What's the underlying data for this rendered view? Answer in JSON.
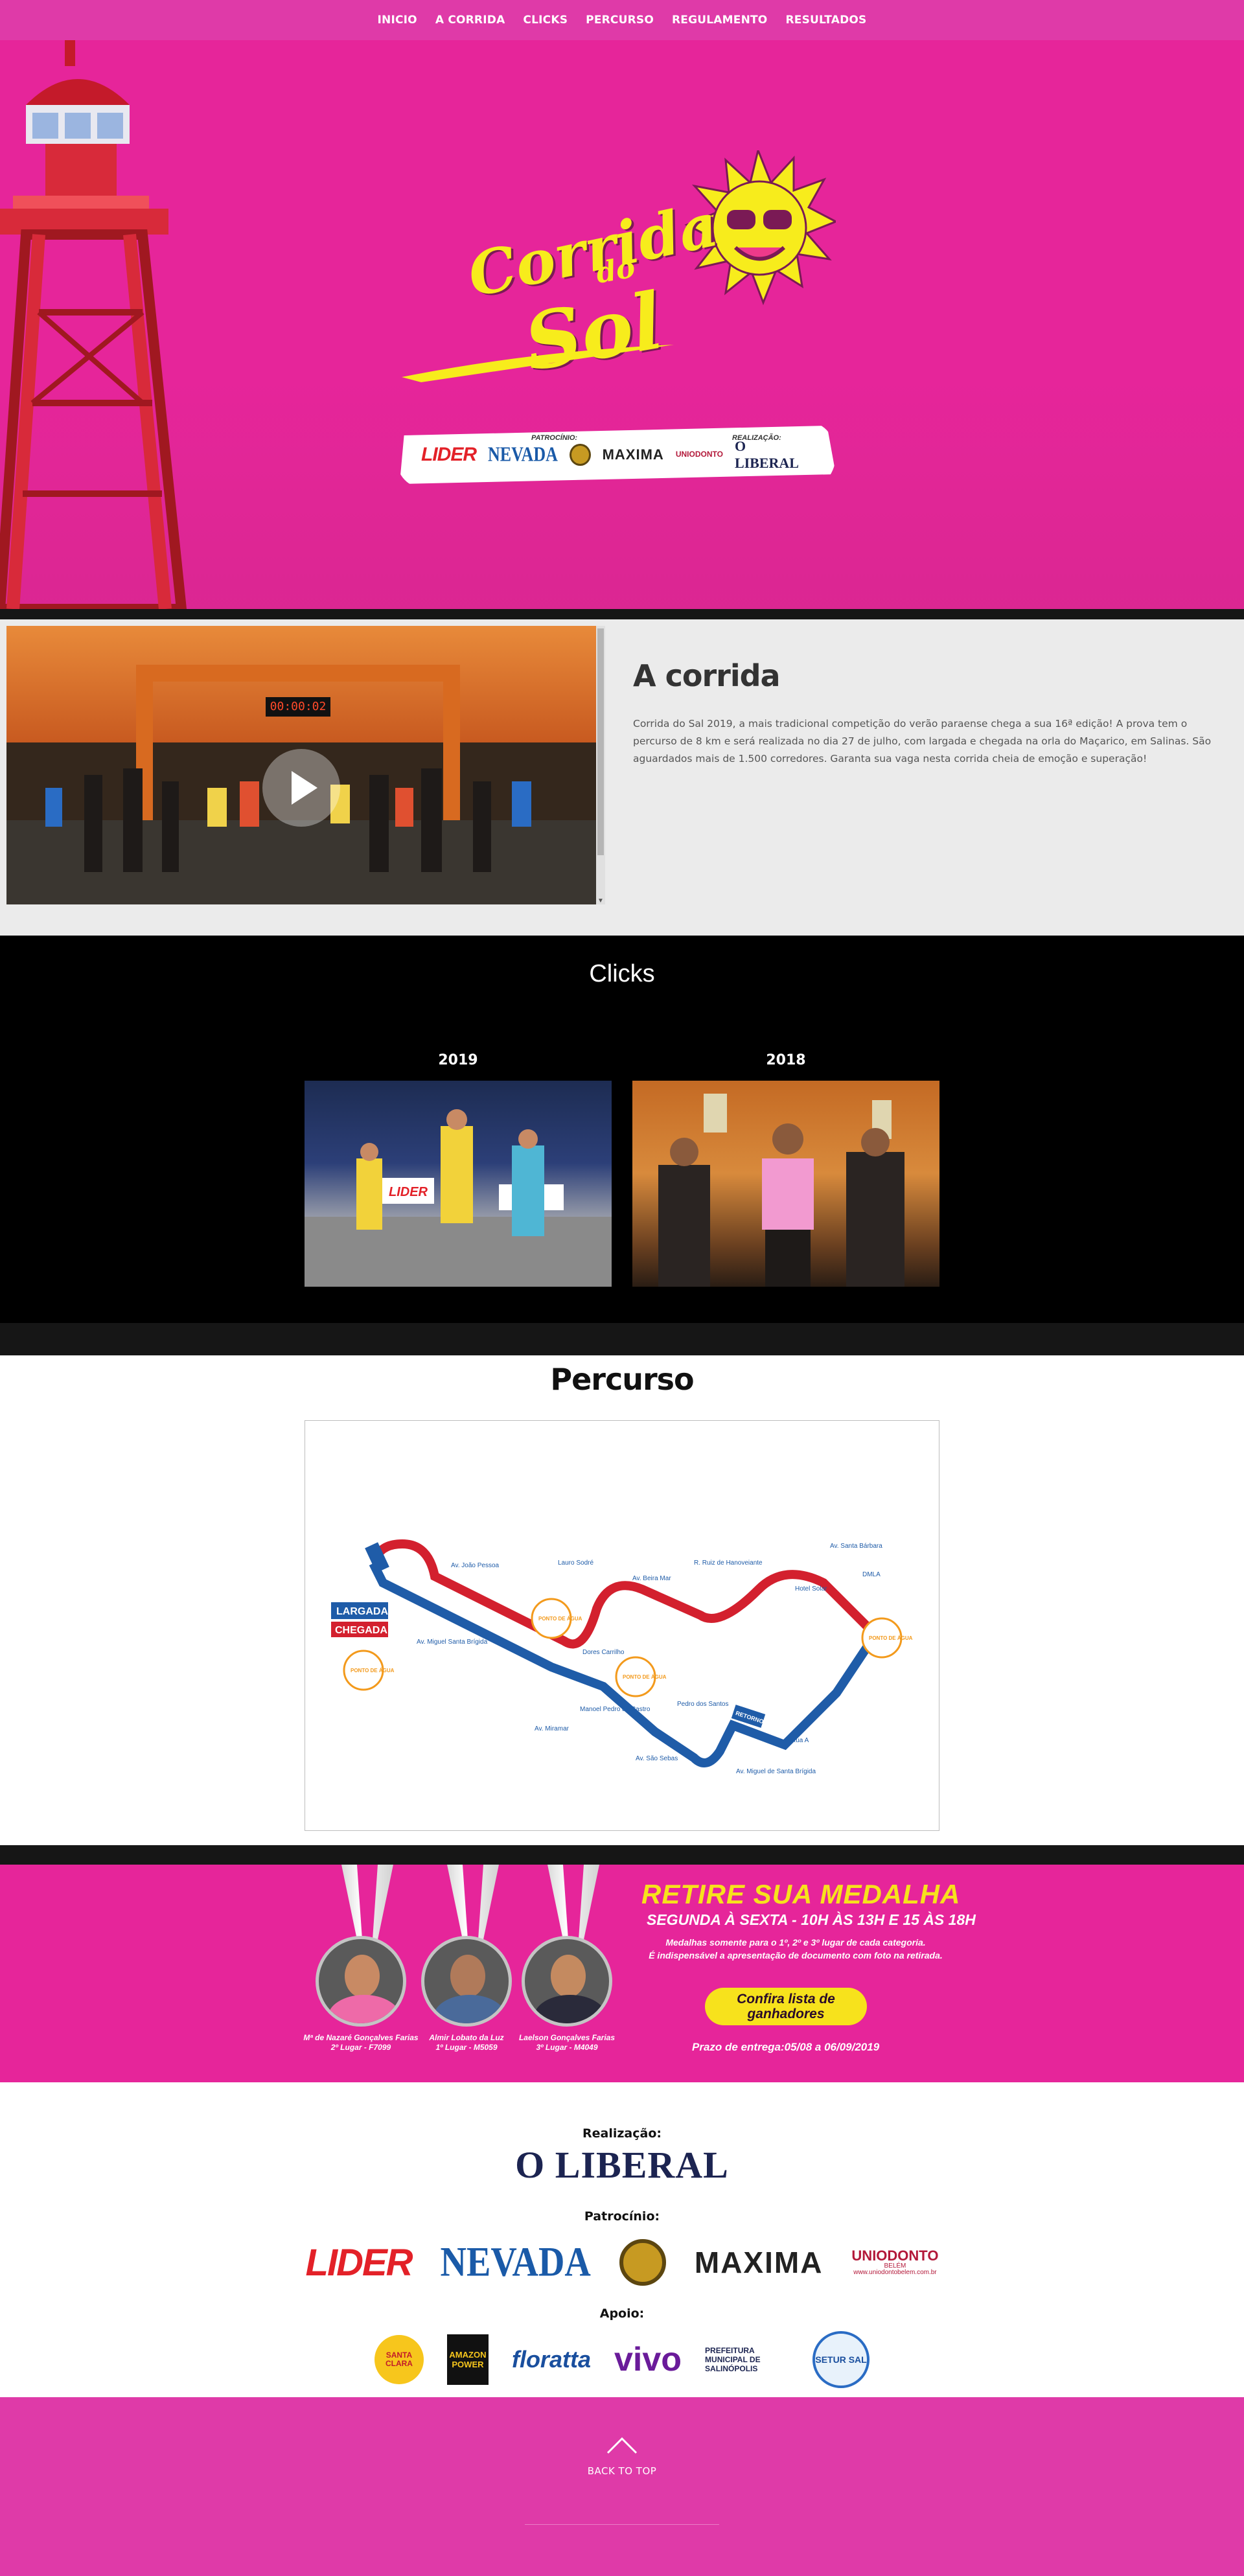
{
  "nav": {
    "items": [
      "INICIO",
      "A CORRIDA",
      "CLICKS",
      "PERCURSO",
      "REGULAMENTO",
      "RESULTADOS"
    ]
  },
  "hero": {
    "logo_line1": "Corrida",
    "logo_do": "do",
    "logo_line2": "Sol",
    "strip": {
      "patrocinio_label": "PATROCÍNIO:",
      "realizacao_label": "REALIZAÇÃO:",
      "lider": "LIDER",
      "nevada": "NEVADA",
      "maxima": "MAXIMA",
      "uniodonto": "UNIODONTO",
      "oliberal": "O LIBERAL"
    }
  },
  "corrida": {
    "title": "A corrida",
    "text": "Corrida do Sal 2019, a mais tradicional competição do verão paraense chega a sua 16ª edição! A prova tem o percurso de 8 km e será realizada no dia 27 de julho, com largada e chegada na orla do Maçarico, em Salinas. São aguardados mais de 1.500 corredores. Garanta sua vaga nesta corrida cheia de emoção e superação!",
    "video_clock": "00:00:02"
  },
  "clicks": {
    "title": "Clicks",
    "galleries": [
      {
        "year": "2019"
      },
      {
        "year": "2018"
      }
    ]
  },
  "percurso": {
    "title": "Percurso",
    "map": {
      "largada": "LARGADA",
      "chegada": "CHEGADA",
      "streets": [
        "Av. João Pessoa",
        "Lauro Sodré",
        "Av. Beira Mar",
        "R. Ruiz de Hanoveiante",
        "Av. Santa Bárbara",
        "Hotel Solar",
        "DMLA",
        "Av. Miguel de Santa Brígida",
        "Av. São Sebas",
        "Rua A",
        "Pedro dos Santos",
        "Manoel Pedro de Castro",
        "Av. Miramar",
        "Dores Carrilho",
        "Av. Miguel Santa Brígida"
      ],
      "ponto": "PONTO DE ÁGUA",
      "retorno": "RETORNO"
    },
    "colors": {
      "red_route": "#d3202e",
      "blue_route": "#1f5ca8",
      "water_point": "#f39a1c"
    }
  },
  "medalha": {
    "title": "RETIRE SUA MEDALHA",
    "horario": "SEGUNDA À SEXTA - 10H ÀS 13H E 15 ÀS 18H",
    "info1": "Medalhas somente para o 1º, 2º e 3º lugar de cada categoria.",
    "info2": "É indispensável a apresentação de documento com foto na retirada.",
    "button": "Confira lista de ganhadores",
    "prazo": "Prazo de entrega:05/08 a 06/09/2019",
    "winners": [
      {
        "name": "Mª de Nazaré Gonçalves Farias",
        "place": "2º Lugar - F7099"
      },
      {
        "name": "Almir Lobato da Luz",
        "place": "1º Lugar - M5059"
      },
      {
        "name": "Laelson Gonçalves Farias",
        "place": "3º Lugar - M4049"
      }
    ]
  },
  "sponsors": {
    "realizacao_label": "Realização:",
    "realizacao": "O LIBERAL",
    "patrocinio_label": "Patrocínio:",
    "patrocinio": [
      "LIDER",
      "NEVADA",
      "MAXIMA",
      "UNIODONTO"
    ],
    "uniodonto_sub": "BELÉM",
    "uniodonto_url": "www.uniodontobelem.com.br",
    "apoio_label": "Apoio:",
    "apoio": {
      "santa_clara": "SANTA CLARA",
      "amazon_power": "AMAZON POWER",
      "floratta": "floratta",
      "vivo": "vivo",
      "prefeitura": "PREFEITURA MUNICIPAL DE SALINÓPOLIS",
      "setur": "SETUR SAL"
    }
  },
  "footer": {
    "back_to_top": "BACK TO TOP"
  },
  "colors": {
    "brand_pink": "#e6259a",
    "nav_pink": "#df3aa8",
    "yellow": "#f7e21c",
    "dark": "#161616"
  }
}
